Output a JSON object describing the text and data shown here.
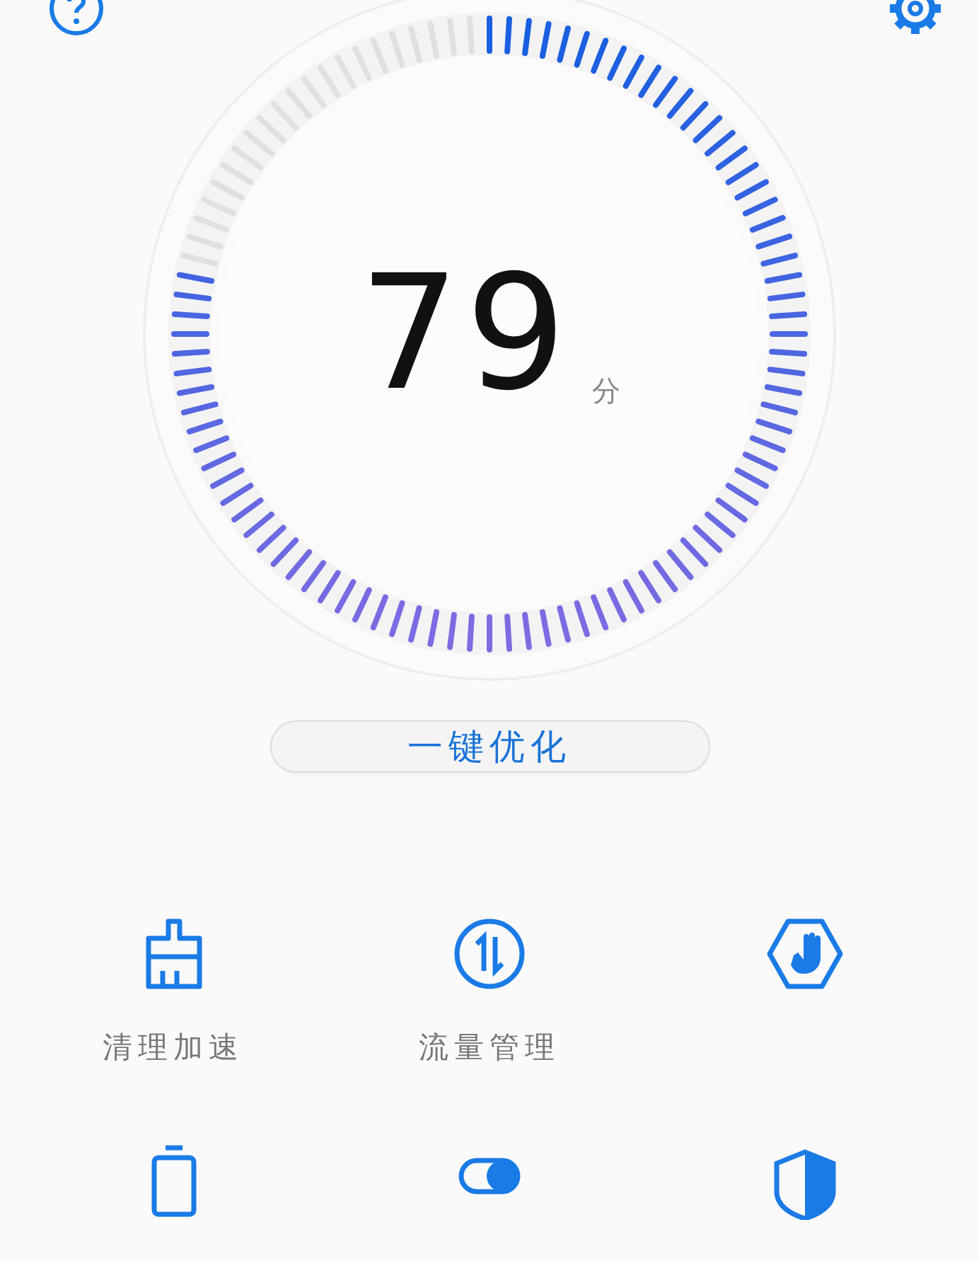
{
  "score": {
    "value": "79",
    "unit": "分"
  },
  "optimize_button": {
    "label": "一键优化"
  },
  "tools": [
    {
      "kind": "broom",
      "label": "清理加速"
    },
    {
      "kind": "traffic",
      "label": "流量管理"
    },
    {
      "kind": "hand"
    },
    {
      "kind": "battery"
    },
    {
      "kind": "toggle"
    },
    {
      "kind": "shield"
    }
  ]
}
